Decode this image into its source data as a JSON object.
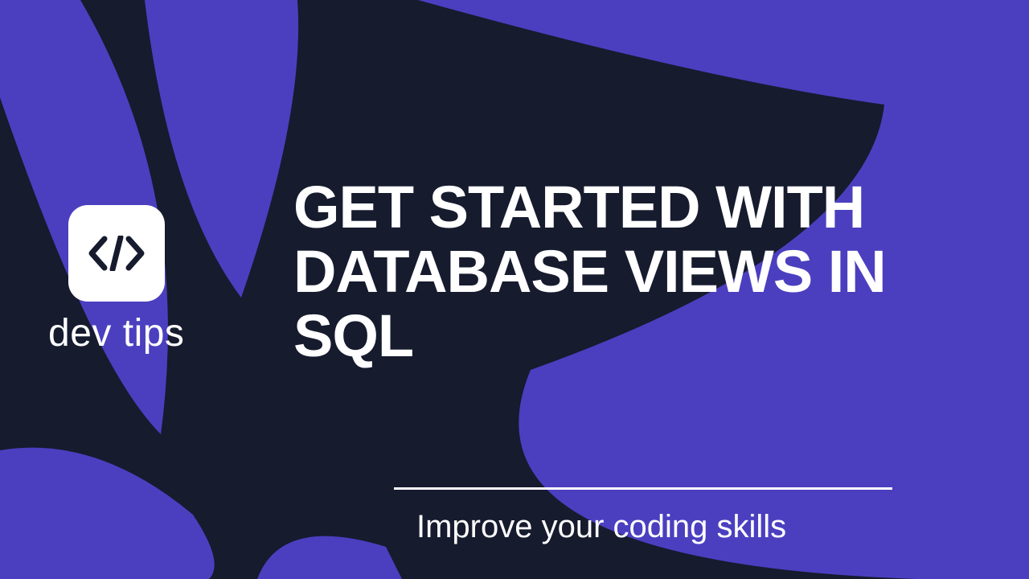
{
  "brand": {
    "name": "dev tips",
    "icon_name": "code-icon"
  },
  "headline": "GET STARTED WITH DATABASE VIEWS IN SQL",
  "tagline": "Improve your coding skills",
  "colors": {
    "background": "#161b2e",
    "accent": "#4b3fc0",
    "text": "#ffffff"
  }
}
